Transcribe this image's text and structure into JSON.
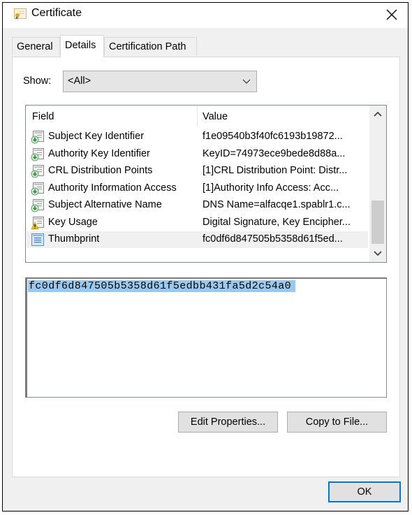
{
  "window": {
    "title": "Certificate",
    "icon": "certificate-icon",
    "close_icon": "close-icon"
  },
  "tabs": [
    {
      "label": "General",
      "active": false
    },
    {
      "label": "Details",
      "active": true
    },
    {
      "label": "Certification Path",
      "active": false
    }
  ],
  "show": {
    "label": "Show:",
    "selected": "<All>"
  },
  "fields_list": {
    "columns": [
      "Field",
      "Value"
    ],
    "rows": [
      {
        "icon": "extension-icon",
        "field": "Subject Key Identifier",
        "value": "f1e09540b3f40fc6193b19872..."
      },
      {
        "icon": "extension-icon",
        "field": "Authority Key Identifier",
        "value": "KeyID=74973ece9bede8d88a..."
      },
      {
        "icon": "extension-icon",
        "field": "CRL Distribution Points",
        "value": "[1]CRL Distribution Point: Distr..."
      },
      {
        "icon": "extension-icon",
        "field": "Authority Information Access",
        "value": "[1]Authority Info Access: Acc..."
      },
      {
        "icon": "extension-icon",
        "field": "Subject Alternative Name",
        "value": "DNS Name=alfacqe1.spablr1.c..."
      },
      {
        "icon": "critical-extension-icon",
        "field": "Key Usage",
        "value": "Digital Signature, Key Encipher..."
      },
      {
        "icon": "property-icon",
        "field": "Thumbprint",
        "value": "fc0df6d847505b5358d61f5ed...",
        "selected": true
      }
    ]
  },
  "detail_value": "fc0df6d847505b5358d61f5edbb431fa5d2c54a0",
  "buttons": {
    "edit_properties": "Edit Properties...",
    "copy_to_file": "Copy to File...",
    "ok": "OK"
  },
  "colors": {
    "selection_highlight": "#99c9ef",
    "default_button_border": "#0078d7"
  }
}
